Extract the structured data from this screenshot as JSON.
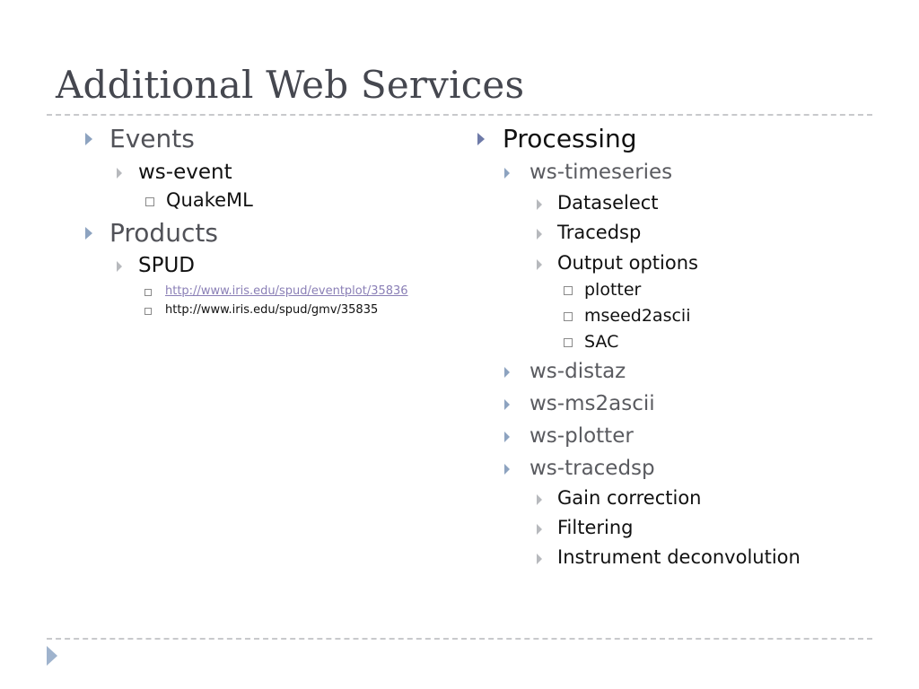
{
  "slide": {
    "title": "Additional Web Services"
  },
  "left_column": {
    "events": {
      "label": "Events",
      "ws_event": {
        "label": "ws-event",
        "children": [
          "QuakeML"
        ]
      }
    },
    "products": {
      "label": "Products",
      "spud": {
        "label": "SPUD",
        "links": [
          {
            "text": "http://www.iris.edu/spud/eventplot/35836",
            "hyperlink": true
          },
          {
            "text": "http://www.iris.edu/spud/gmv/35835",
            "hyperlink": false
          }
        ]
      }
    }
  },
  "right_column": {
    "processing": {
      "label": "Processing",
      "ws_timeseries": {
        "label": "ws-timeseries",
        "children": [
          "Dataselect",
          "Tracedsp",
          "Output options"
        ],
        "output_options": [
          "plotter",
          "mseed2ascii",
          "SAC"
        ]
      },
      "services": [
        "ws-distaz",
        "ws-ms2ascii",
        "ws-plotter",
        "ws-tracedsp"
      ],
      "tracedsp_children": [
        "Gain correction",
        "Filtering",
        "Instrument deconvolution"
      ]
    }
  },
  "colors": {
    "title": "#45474f",
    "link": "#8a7fb6",
    "bullet_level1": "#8da3c0",
    "bullet_level2": "#b7b9bd"
  }
}
